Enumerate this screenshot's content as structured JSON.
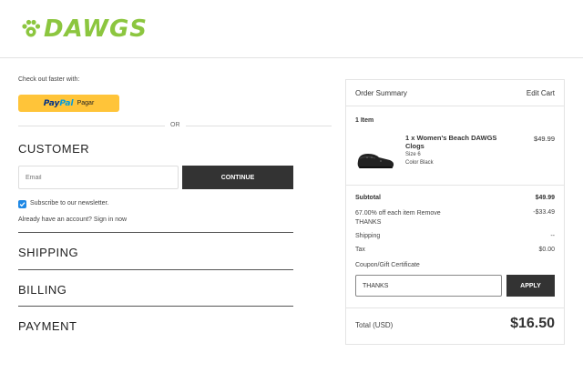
{
  "header": {
    "logo_text": "DAWGS",
    "logo_icon": "paw-print-icon",
    "brand_color": "#8cc63f"
  },
  "checkout": {
    "faster_text": "Check out faster with:",
    "paypal": {
      "pay": "Pay",
      "pal": "Pal",
      "action": "Pagar",
      "button_color": "#ffc439"
    },
    "or_text": "OR",
    "customer_title": "CUSTOMER",
    "email_placeholder": "Email",
    "email_value": "",
    "continue_label": "CONTINUE",
    "newsletter_label": "Subscribe to our newsletter.",
    "newsletter_checked": true,
    "signin_text": "Already have an account? Sign in now",
    "shipping_title": "SHIPPING",
    "billing_title": "BILLING",
    "payment_title": "PAYMENT"
  },
  "summary": {
    "title": "Order Summary",
    "edit_cart": "Edit Cart",
    "items_count": "1 Item",
    "item": {
      "name": "1 x Women's Beach DAWGS Clogs",
      "size": "Size 6",
      "color": "Color Black",
      "price": "$49.99",
      "image_icon": "black-clog-icon"
    },
    "subtotal_label": "Subtotal",
    "subtotal_value": "$49.99",
    "discount_label": "67.00% off each item Remove THANKS",
    "discount_value": "-$33.49",
    "shipping_label": "Shipping",
    "shipping_value": "--",
    "tax_label": "Tax",
    "tax_value": "$0.00",
    "coupon_label": "Coupon/Gift Certificate",
    "coupon_value": "THANKS",
    "apply_label": "APPLY",
    "total_label": "Total (USD)",
    "total_value": "$16.50"
  }
}
